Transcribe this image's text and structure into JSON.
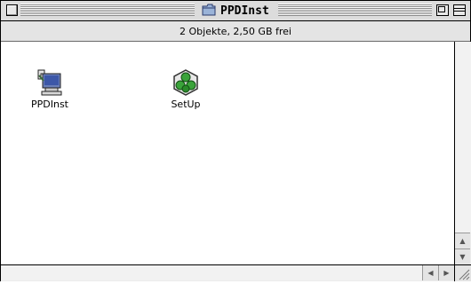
{
  "window": {
    "title": "PPDInst"
  },
  "info": {
    "text": "2 Objekte, 2,50 GB frei"
  },
  "files": [
    {
      "label": "PPDInst",
      "icon": "installer-computer-icon"
    },
    {
      "label": "SetUp",
      "icon": "setup-hexagon-icon"
    }
  ],
  "scroll": {
    "up": "▲",
    "down": "▼",
    "left": "◀",
    "right": "▶"
  }
}
